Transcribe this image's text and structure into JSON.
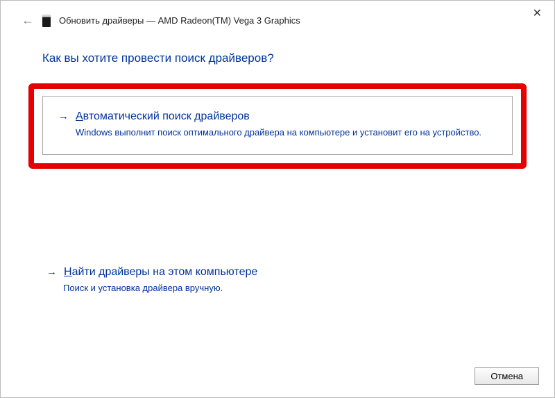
{
  "window": {
    "title": "Обновить драйверы — AMD Radeon(TM) Vega 3 Graphics"
  },
  "heading": "Как вы хотите провести поиск драйверов?",
  "options": {
    "auto": {
      "title_prefix": "А",
      "title_rest": "втоматический поиск драйверов",
      "description": "Windows выполнит поиск оптимального драйвера на компьютере и установит его на устройство."
    },
    "manual": {
      "title_prefix": "Н",
      "title_rest": "айти драйверы на этом компьютере",
      "description": "Поиск и установка драйвера вручную."
    }
  },
  "buttons": {
    "cancel": "Отмена"
  }
}
